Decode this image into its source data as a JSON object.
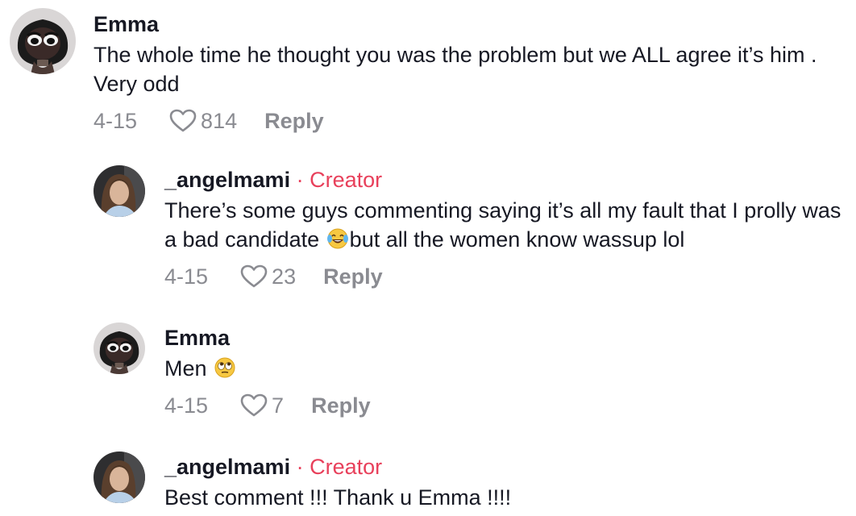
{
  "comments": [
    {
      "author": "Emma",
      "creator_label": "",
      "avatar_icon": "cartoon-avatar-icon",
      "text_parts": [
        "The whole time he thought you was the problem but we ALL agree it’s him . Very odd"
      ],
      "date": "4-15",
      "likes": "814",
      "reply_label": "Reply"
    },
    {
      "author": "_angelmami",
      "creator_label": "Creator",
      "avatar_icon": "photo-avatar-icon",
      "text_parts": [
        "There’s some guys commenting saying it’s all my fault that I prolly was a bad candidate ",
        "but all the women know wassup lol"
      ],
      "emoji_icon": "laughing-tears-emoji-icon",
      "date": "4-15",
      "likes": "23",
      "reply_label": "Reply"
    },
    {
      "author": "Emma",
      "creator_label": "",
      "avatar_icon": "cartoon-avatar-icon",
      "text_parts": [
        "Men "
      ],
      "emoji_icon": "eye-roll-emoji-icon",
      "date": "4-15",
      "likes": "7",
      "reply_label": "Reply"
    },
    {
      "author": "_angelmami",
      "creator_label": "Creator",
      "avatar_icon": "photo-avatar-icon",
      "text_parts": [
        "Best comment !!! Thank u Emma !!!!"
      ],
      "date": "",
      "likes": "",
      "reply_label": ""
    }
  ],
  "separator": " · ",
  "colors": {
    "text": "#161823",
    "meta": "#8a8b91",
    "creator": "#e8405b"
  }
}
